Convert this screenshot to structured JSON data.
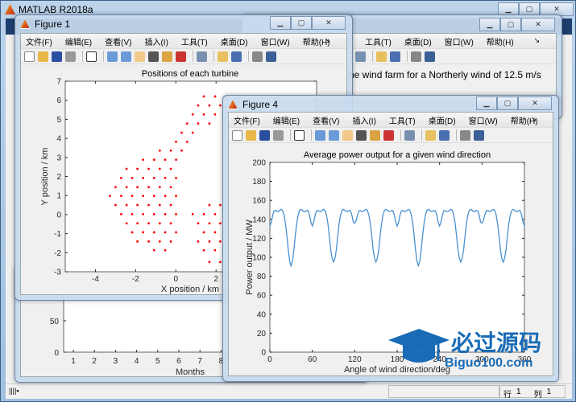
{
  "app": {
    "title": "MATLAB R2018a",
    "status": {
      "row_label": "行",
      "row": "1",
      "col_label": "列",
      "col": "1"
    }
  },
  "menu_items": [
    "文件(F)",
    "编辑(E)",
    "查看(V)",
    "插入(I)",
    "工具(T)",
    "桌面(D)",
    "窗口(W)",
    "帮助(H)"
  ],
  "back_menu_items": [
    "工具(T)",
    "桌面(D)",
    "窗口(W)",
    "帮助(H)"
  ],
  "toolbar_icons": [
    "new-file-icon",
    "open-folder-icon",
    "save-icon",
    "print-icon",
    "|",
    "pointer-icon",
    "|",
    "zoom-in-icon",
    "zoom-out-icon",
    "pan-hand-icon",
    "rotate-3d-icon",
    "data-cursor-icon",
    "brush-icon",
    "|",
    "link-plot-icon",
    "|",
    "colorbar-icon",
    "legend-icon",
    "|",
    "hide-plot-tools-icon",
    "show-plot-tools-icon"
  ],
  "back_figure": {
    "title_fragment": "ne wind farm for a Northerly wind of 12.5 m/s"
  },
  "figure1": {
    "title": "Figure 1"
  },
  "figure4": {
    "title": "Figure 4"
  },
  "watermark": {
    "text": "必过源码",
    "url": "Biguo100.com"
  },
  "colors": {
    "scatter": "#ff0000",
    "line": "#4a90d0",
    "title_bar": "#c8daee",
    "accent": "#1a6bb5"
  },
  "chart_data": [
    {
      "id": "positions",
      "type": "scatter",
      "title": "Positions of each turbine",
      "xlabel": "X position / km",
      "ylabel": "Y position / km",
      "xlim": [
        -5.5,
        7
      ],
      "ylim": [
        -3,
        7
      ],
      "xticks": [
        -4,
        -2,
        0,
        2
      ],
      "yticks": [
        -3,
        -2,
        -1,
        0,
        1,
        2,
        3,
        4,
        5,
        6,
        7
      ],
      "marker": "dot",
      "points": [
        [
          1.39,
          6.2
        ],
        [
          1.95,
          6.2
        ],
        [
          2.49,
          6.2
        ],
        [
          1.11,
          5.73
        ],
        [
          1.67,
          5.73
        ],
        [
          2.21,
          5.73
        ],
        [
          0.84,
          5.26
        ],
        [
          1.39,
          5.26
        ],
        [
          1.95,
          5.26
        ],
        [
          0.56,
          4.78
        ],
        [
          1.11,
          4.78
        ],
        [
          1.67,
          4.78
        ],
        [
          0.29,
          4.3
        ],
        [
          0.84,
          4.3
        ],
        [
          0.01,
          3.82
        ],
        [
          0.56,
          3.82
        ],
        [
          -0.8,
          3.36
        ],
        [
          -0.25,
          3.36
        ],
        [
          0.29,
          3.36
        ],
        [
          -1.63,
          2.88
        ],
        [
          -1.08,
          2.88
        ],
        [
          -0.53,
          2.88
        ],
        [
          0.01,
          2.88
        ],
        [
          -2.45,
          2.4
        ],
        [
          -1.91,
          2.4
        ],
        [
          -1.35,
          2.4
        ],
        [
          -0.8,
          2.4
        ],
        [
          -0.25,
          2.4
        ],
        [
          -2.72,
          1.92
        ],
        [
          -2.17,
          1.92
        ],
        [
          -1.63,
          1.92
        ],
        [
          -1.08,
          1.92
        ],
        [
          -0.53,
          1.92
        ],
        [
          0.01,
          1.92
        ],
        [
          -3.0,
          1.44
        ],
        [
          -2.45,
          1.44
        ],
        [
          -1.91,
          1.44
        ],
        [
          -1.35,
          1.44
        ],
        [
          -0.8,
          1.44
        ],
        [
          -0.25,
          1.44
        ],
        [
          -3.28,
          0.98
        ],
        [
          -2.72,
          0.98
        ],
        [
          -2.17,
          0.98
        ],
        [
          -1.63,
          0.98
        ],
        [
          -1.08,
          0.98
        ],
        [
          -0.53,
          0.98
        ],
        [
          0.01,
          0.98
        ],
        [
          -3.0,
          0.5
        ],
        [
          -2.45,
          0.5
        ],
        [
          -1.91,
          0.5
        ],
        [
          -1.35,
          0.5
        ],
        [
          -0.8,
          0.5
        ],
        [
          -0.25,
          0.5
        ],
        [
          1.67,
          0.5
        ],
        [
          2.21,
          0.5
        ],
        [
          -2.72,
          0.02
        ],
        [
          -2.17,
          0.02
        ],
        [
          -1.63,
          0.02
        ],
        [
          -1.08,
          0.02
        ],
        [
          -0.53,
          0.02
        ],
        [
          0.01,
          0.02
        ],
        [
          0.84,
          0.02
        ],
        [
          1.39,
          0.02
        ],
        [
          1.95,
          0.02
        ],
        [
          -2.45,
          -0.46
        ],
        [
          -1.91,
          -0.46
        ],
        [
          -1.35,
          -0.46
        ],
        [
          -0.8,
          -0.46
        ],
        [
          -0.25,
          -0.46
        ],
        [
          1.11,
          -0.46
        ],
        [
          1.67,
          -0.46
        ],
        [
          2.21,
          -0.46
        ],
        [
          -2.17,
          -0.93
        ],
        [
          -1.63,
          -0.93
        ],
        [
          -1.08,
          -0.93
        ],
        [
          -0.53,
          -0.93
        ],
        [
          0.01,
          -0.93
        ],
        [
          1.39,
          -0.93
        ],
        [
          1.95,
          -0.93
        ],
        [
          -1.91,
          -1.41
        ],
        [
          -1.35,
          -1.41
        ],
        [
          -0.8,
          -1.41
        ],
        [
          -0.25,
          -1.41
        ],
        [
          1.11,
          -1.41
        ],
        [
          1.67,
          -1.41
        ],
        [
          2.21,
          -1.41
        ],
        [
          -1.08,
          -1.87
        ],
        [
          -0.53,
          -1.87
        ],
        [
          1.39,
          -1.87
        ],
        [
          1.95,
          -1.87
        ],
        [
          1.67,
          -2.49
        ],
        [
          2.21,
          -2.49
        ]
      ]
    },
    {
      "id": "power",
      "type": "line",
      "title": "Average power output for a given wind direction",
      "xlabel": "Angle of wind direction/deg",
      "ylabel": "Power output / MW",
      "xlim": [
        0,
        360
      ],
      "ylim": [
        0,
        200
      ],
      "xticks": [
        0,
        60,
        120,
        180,
        240,
        300,
        360
      ],
      "yticks": [
        0,
        20,
        40,
        60,
        80,
        100,
        120,
        140,
        160,
        180,
        200
      ],
      "x": [
        0,
        2,
        4,
        6,
        8,
        10,
        12,
        14,
        16,
        18,
        20,
        22,
        24,
        26,
        28,
        30,
        32,
        34,
        36,
        38,
        40,
        42,
        44,
        46,
        48,
        50,
        52,
        54,
        56,
        58,
        60,
        62,
        64,
        66,
        68,
        70,
        72,
        74,
        76,
        78,
        80,
        82,
        84,
        86,
        88,
        90,
        92,
        94,
        96,
        98,
        100,
        102,
        104,
        106,
        108,
        110,
        112,
        114,
        116,
        118,
        120,
        122,
        124,
        126,
        128,
        130,
        132,
        134,
        136,
        138,
        140,
        142,
        144,
        146,
        148,
        150,
        152,
        154,
        156,
        158,
        160,
        162,
        164,
        166,
        168,
        170,
        172,
        174,
        176,
        178,
        180,
        182,
        184,
        186,
        188,
        190,
        192,
        194,
        196,
        198,
        200,
        202,
        204,
        206,
        208,
        210,
        212,
        214,
        216,
        218,
        220,
        222,
        224,
        226,
        228,
        230,
        232,
        234,
        236,
        238,
        240,
        242,
        244,
        246,
        248,
        250,
        252,
        254,
        256,
        258,
        260,
        262,
        264,
        266,
        268,
        270,
        272,
        274,
        276,
        278,
        280,
        282,
        284,
        286,
        288,
        290,
        292,
        294,
        296,
        298,
        300,
        302,
        304,
        306,
        308,
        310,
        312,
        314,
        316,
        318,
        320,
        322,
        324,
        326,
        328,
        330,
        332,
        334,
        336,
        338,
        340,
        342,
        344,
        346,
        348,
        350,
        352,
        354,
        356,
        358,
        360
      ],
      "y": [
        133,
        137,
        144.5,
        149,
        149.4,
        148.2,
        148.2,
        149.6,
        150.6,
        149.2,
        144.6,
        135.8,
        123,
        108,
        95.8,
        91,
        95.8,
        108,
        123,
        135.8,
        144.6,
        149.2,
        150.6,
        149.6,
        148.2,
        148.2,
        149.4,
        149,
        144.5,
        137,
        133,
        137,
        144.5,
        149,
        149.4,
        148.2,
        148.2,
        149.6,
        150.6,
        149.2,
        144.6,
        135.8,
        123,
        108,
        99,
        95,
        99,
        108,
        123,
        135.8,
        144.6,
        149.2,
        150.6,
        149.6,
        148.2,
        148.2,
        149.4,
        149,
        144.5,
        137,
        136,
        139,
        144.5,
        149,
        149.4,
        148.2,
        148.2,
        149.6,
        150.6,
        149.2,
        144.6,
        135.8,
        123,
        108,
        99,
        95,
        99,
        108,
        123,
        135.8,
        144.6,
        149.2,
        150.6,
        149.6,
        148.2,
        148.2,
        149.4,
        149,
        144.5,
        137,
        133,
        137,
        144.5,
        149,
        149.4,
        148.2,
        148.2,
        149.6,
        150.6,
        149.2,
        144.6,
        135.8,
        123,
        108,
        95.8,
        91,
        95.8,
        108,
        123,
        135.8,
        144.6,
        149.2,
        150.6,
        149.6,
        148.2,
        148.2,
        149.4,
        149,
        144.5,
        137,
        133,
        137,
        144.5,
        149,
        149.4,
        148.2,
        148.2,
        149.6,
        150.6,
        149.2,
        144.6,
        135.8,
        123,
        108,
        99,
        95,
        99,
        108,
        123,
        135.8,
        144.6,
        149.2,
        150.6,
        149.6,
        148.2,
        148.2,
        149.4,
        149,
        144.5,
        137,
        136,
        139,
        144.5,
        149,
        149.4,
        148.2,
        148.2,
        149.6,
        150.6,
        149.2,
        144.6,
        135.8,
        123,
        108,
        99,
        95,
        99,
        108,
        123,
        135.8,
        144.6,
        149.2,
        150.6,
        149.6,
        148.2,
        148.2,
        149.4,
        149,
        144.5,
        137,
        133
      ]
    },
    {
      "id": "months",
      "type": "bar",
      "xlabel": "Months",
      "xticks": [
        1,
        2,
        3,
        4,
        5,
        6,
        7,
        8
      ],
      "yticks": [
        0,
        50
      ]
    }
  ]
}
